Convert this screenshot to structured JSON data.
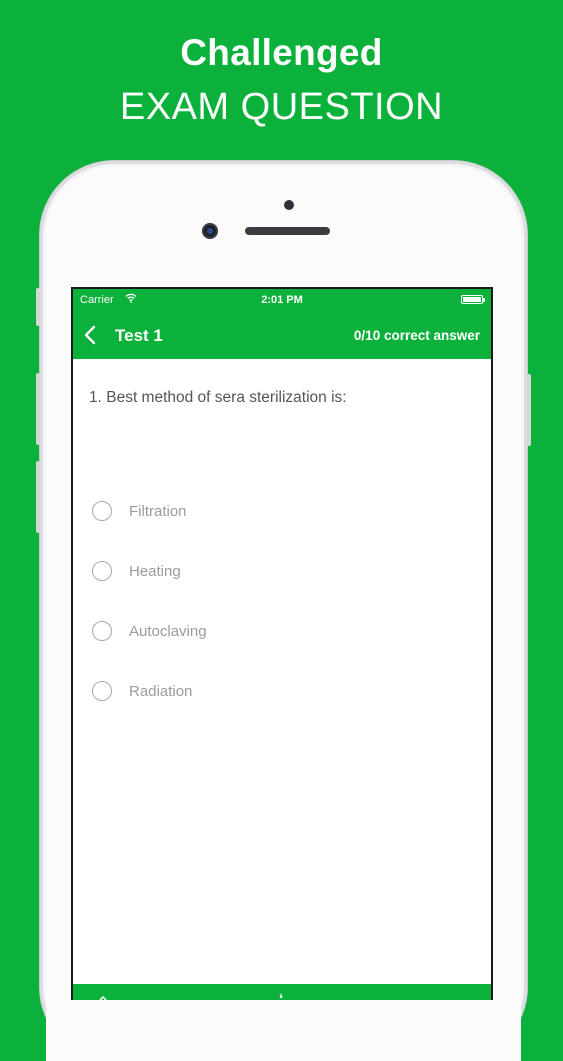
{
  "promo": {
    "line1": "Challenged",
    "line2": "EXAM QUESTION"
  },
  "status_bar": {
    "carrier": "Carrier",
    "time": "2:01 PM"
  },
  "nav": {
    "title": "Test 1",
    "score": "0/10 correct answer"
  },
  "question": {
    "text": "1. Best method of sera sterilization is:",
    "options": [
      {
        "label": "Filtration"
      },
      {
        "label": "Heating"
      },
      {
        "label": "Autoclaving"
      },
      {
        "label": "Radiation"
      }
    ]
  },
  "colors": {
    "brand_green": "#0bb13a",
    "text_gray": "#555555",
    "option_gray": "#9b9b9b"
  },
  "icons": {
    "back": "chevron-left-icon",
    "wifi": "wifi-icon",
    "battery": "battery-icon",
    "radio": "radio-unselected-icon"
  }
}
